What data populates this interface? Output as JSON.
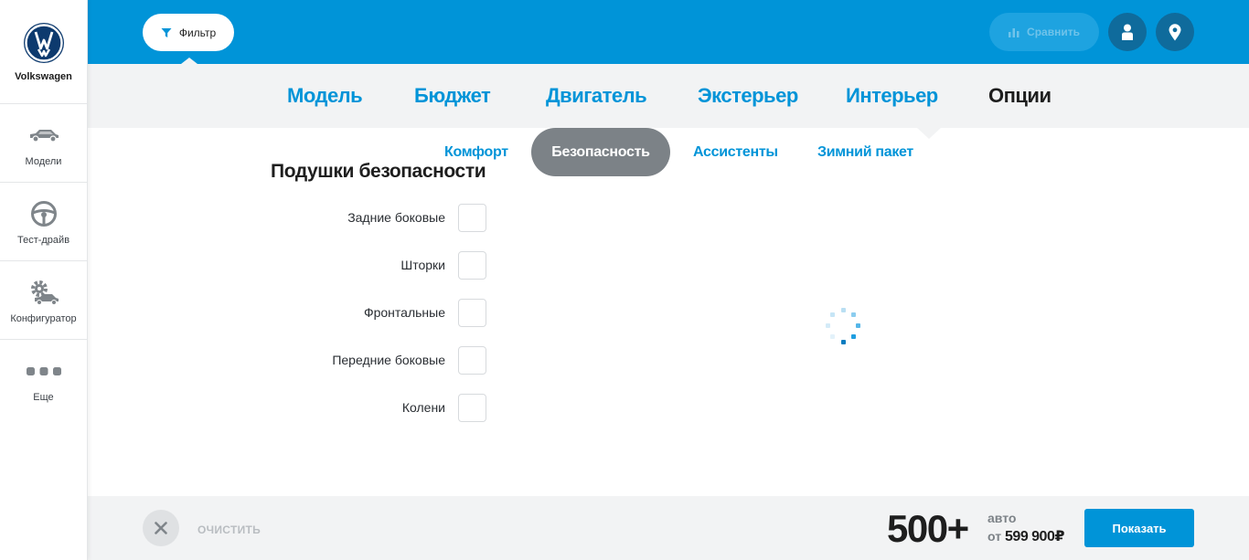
{
  "sidebar": {
    "brand": "Volkswagen",
    "items": [
      {
        "label": "Модели",
        "icon": "car-icon"
      },
      {
        "label": "Тест-драйв",
        "icon": "steering-wheel-icon"
      },
      {
        "label": "Конфигуратор",
        "icon": "configurator-gear-car-icon"
      },
      {
        "label": "Еще",
        "icon": "more-dots-icon"
      }
    ]
  },
  "topbar": {
    "filter_label": "Фильтр",
    "compare_label": "Сравнить",
    "account_icon": "user-icon",
    "location_icon": "location-pin-icon"
  },
  "tabs": [
    {
      "label": "Модель"
    },
    {
      "label": "Бюджет"
    },
    {
      "label": "Двигатель"
    },
    {
      "label": "Экстерьер"
    },
    {
      "label": "Интерьер"
    },
    {
      "label": "Опции",
      "active": true
    }
  ],
  "subtabs": [
    {
      "label": "Комфорт"
    },
    {
      "label": "Безопасность",
      "active": true
    },
    {
      "label": "Ассистенты"
    },
    {
      "label": "Зимний пакет"
    }
  ],
  "section": {
    "title": "Подушки безопасности",
    "options": [
      {
        "label": "Задние боковые",
        "checked": false
      },
      {
        "label": "Шторки",
        "checked": false
      },
      {
        "label": "Фронтальные",
        "checked": false
      },
      {
        "label": "Передние боковые",
        "checked": false
      },
      {
        "label": "Колени",
        "checked": false
      }
    ]
  },
  "footer": {
    "clear_label": "ОЧИСТИТЬ",
    "count": "500+",
    "count_unit": "авто",
    "price_prefix": "от",
    "price": "599 900₽",
    "show_label": "Показать"
  },
  "colors": {
    "accent": "#0094d8",
    "accent_dark": "#0f6b9c",
    "panel": "#f2f3f4",
    "active_pill": "#7c8287"
  }
}
